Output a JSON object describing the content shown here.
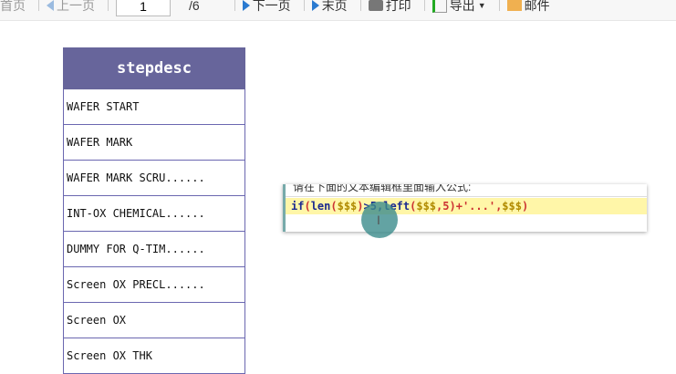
{
  "toolbar": {
    "first": "首页",
    "prev": "上一页",
    "page": "1",
    "total": "/6",
    "next": "下一页",
    "last": "末页",
    "print": "打印",
    "export": "导出",
    "mail": "邮件"
  },
  "table": {
    "header": "stepdesc",
    "rows": [
      "WAFER START",
      "WAFER MARK",
      "WAFER MARK SCRU......",
      "INT-OX CHEMICAL......",
      "DUMMY FOR Q-TIM......",
      "Screen OX PRECL......",
      "Screen OX",
      "Screen OX THK"
    ]
  },
  "editor": {
    "prompt": "请在下面的文本编辑框里面输入公式:",
    "code": {
      "t1": "if",
      "t2": "(",
      "t3": "len",
      "t4": "(",
      "t5": "$$$",
      "t6": ")",
      "t7": ">5,",
      "t8": "left",
      "t9": "(",
      "t10": "$$$",
      "t11": ",5)+'...',",
      "t12": "$$$",
      "t13": ")"
    }
  }
}
